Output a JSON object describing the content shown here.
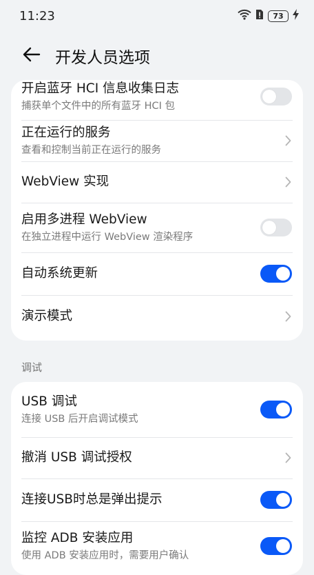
{
  "status_bar": {
    "time": "11:23",
    "battery_level": "73",
    "icons": [
      "wifi-icon",
      "sim-alert-icon",
      "battery-icon",
      "charging-icon"
    ]
  },
  "header": {
    "title": "开发人员选项",
    "back_icon": "back-arrow-icon"
  },
  "accent_color": "#0a59f7",
  "group1": {
    "items": [
      {
        "title": "开启蓝牙 HCI 信息收集日志",
        "subtitle": "捕获单个文件中的所有蓝牙 HCI 包",
        "control": "toggle",
        "on": false
      },
      {
        "title": "正在运行的服务",
        "subtitle": "查看和控制当前正在运行的服务",
        "control": "chevron"
      },
      {
        "title": "WebView 实现",
        "control": "chevron"
      },
      {
        "title": "启用多进程 WebView",
        "subtitle": "在独立进程中运行 WebView 渲染程序",
        "control": "toggle",
        "on": false
      },
      {
        "title": "自动系统更新",
        "control": "toggle",
        "on": true
      },
      {
        "title": "演示模式",
        "control": "chevron"
      }
    ]
  },
  "section_debug": {
    "label": "调试",
    "items": [
      {
        "title": "USB 调试",
        "subtitle": "连接 USB 后开启调试模式",
        "control": "toggle",
        "on": true
      },
      {
        "title": "撤消 USB 调试授权",
        "control": "chevron"
      },
      {
        "title": "连接USB时总是弹出提示",
        "control": "toggle",
        "on": true
      },
      {
        "title": "监控 ADB 安装应用",
        "subtitle": "使用 ADB 安装应用时，需要用户确认",
        "control": "toggle",
        "on": true
      }
    ]
  }
}
